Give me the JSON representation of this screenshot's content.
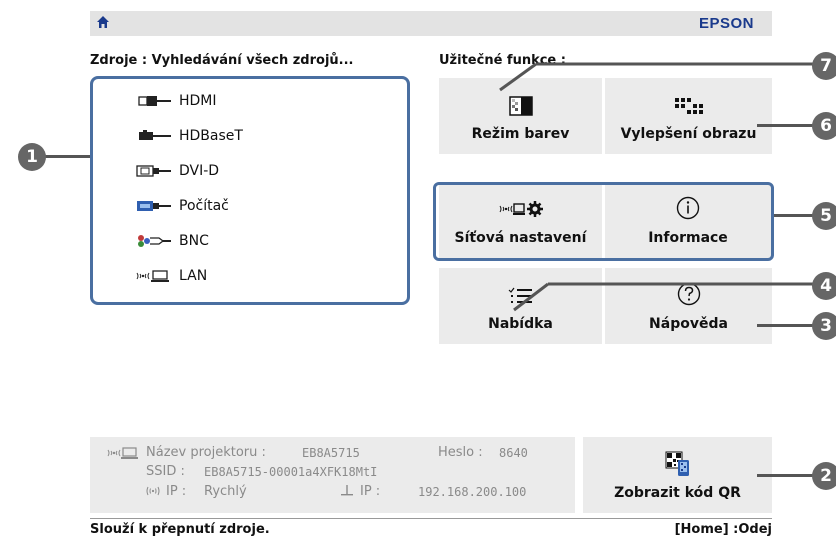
{
  "header": {
    "brand": "EPSON",
    "home_icon": "home-icon"
  },
  "sources": {
    "header": "Zdroje : Vyhledávání všech zdrojů...",
    "items": [
      {
        "label": "HDMI",
        "icon": "hdmi-icon"
      },
      {
        "label": "HDBaseT",
        "icon": "hdbaset-icon"
      },
      {
        "label": "DVI-D",
        "icon": "dvi-icon"
      },
      {
        "label": "Počítač",
        "icon": "computer-vga-icon"
      },
      {
        "label": "BNC",
        "icon": "bnc-icon"
      },
      {
        "label": "LAN",
        "icon": "lan-icon"
      }
    ]
  },
  "functions": {
    "header": "Užitečné funkce :",
    "tiles": [
      {
        "label": "Režim barev",
        "icon": "color-mode-icon"
      },
      {
        "label": "Vylepšení obrazu",
        "icon": "image-enhance-icon"
      },
      {
        "label": "Síťová nastavení",
        "icon": "network-settings-icon"
      },
      {
        "label": "Informace",
        "icon": "info-icon"
      },
      {
        "label": "Nabídka",
        "icon": "menu-icon"
      },
      {
        "label": "Nápověda",
        "icon": "help-icon"
      }
    ]
  },
  "info": {
    "projector_label": "Název projektoru :",
    "projector_value": "EB8A5715",
    "password_label": "Heslo :",
    "password_value": "8640",
    "ssid_label": "SSID :",
    "ssid_value": "EB8A5715-00001a4XFK18MtI",
    "ip_label": "IP :",
    "ip_mode": "Rychlý",
    "wired_ip_label": "IP :",
    "wired_ip_value": "192.168.200.100"
  },
  "qr": {
    "label": "Zobrazit kód QR",
    "icon": "qr-code-icon"
  },
  "footer": {
    "hint": "Slouží k přepnutí zdroje.",
    "home_hint": "[Home] :Odej"
  },
  "callouts": [
    "1",
    "2",
    "3",
    "4",
    "5",
    "6",
    "7"
  ]
}
